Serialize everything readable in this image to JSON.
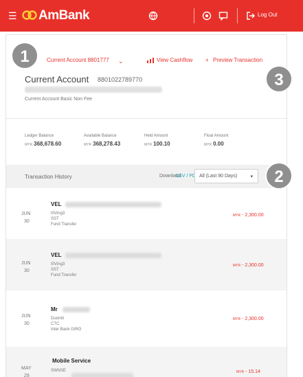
{
  "topbar": {
    "brand": "AmBank",
    "logout_label": "Log Out",
    "icons": [
      "menu-icon",
      "globe-icon",
      "help-icon",
      "message-icon",
      "logout-icon"
    ]
  },
  "account": {
    "selector_label": "Current Account 8801777",
    "view_cashflow": "View Cashflow",
    "preview_transaction": "Preview Transaction",
    "name": "Current Account",
    "number": "8801022789770",
    "type": "Current Account Basic Non Fee"
  },
  "balances": [
    {
      "label": "Ledger Balance",
      "currency": "MYR",
      "value": "368,678.60"
    },
    {
      "label": "Available Balance",
      "currency": "MYR",
      "value": "368,278.43"
    },
    {
      "label": "Held Amount",
      "currency": "MYR",
      "value": "100.10"
    },
    {
      "label": "Float Amount",
      "currency": "MYR",
      "value": "0.00"
    }
  ],
  "history": {
    "title": "Transaction History",
    "download_label": "Download",
    "download_links": "CSV / PDF",
    "filter_value": "All (Last 90 Days)"
  },
  "transactions": [
    {
      "month": "JUN",
      "day": "30",
      "title": "VEL",
      "line1": "I0Ving3",
      "line2": "SST",
      "line3": "Fund Transfer",
      "currency": "MYR",
      "amount": "- 2,300.00"
    },
    {
      "month": "JUN",
      "day": "30",
      "title": "VEL",
      "line1": "I0Ving3",
      "line2": "SST",
      "line3": "Fund Transfer",
      "currency": "MYR",
      "amount": "- 2,300.00"
    },
    {
      "month": "JUN",
      "day": "30",
      "title": "Mr",
      "line1": "Duomit",
      "line2": "CTC",
      "line3": "Inter Bank GIRO",
      "currency": "MYR",
      "amount": "- 2,300.00"
    },
    {
      "month": "MAY",
      "day": "29",
      "title": "Mobile Service",
      "line1": "SWNSE",
      "line2": "",
      "line3": "",
      "currency": "MYR",
      "amount": "- 15.14"
    }
  ],
  "annotations": {
    "badge1": "1",
    "badge2": "2",
    "badge3": "3"
  },
  "colors": {
    "brand": "#e8302a",
    "link": "#19a6b8",
    "badge": "#8f8f8f"
  }
}
